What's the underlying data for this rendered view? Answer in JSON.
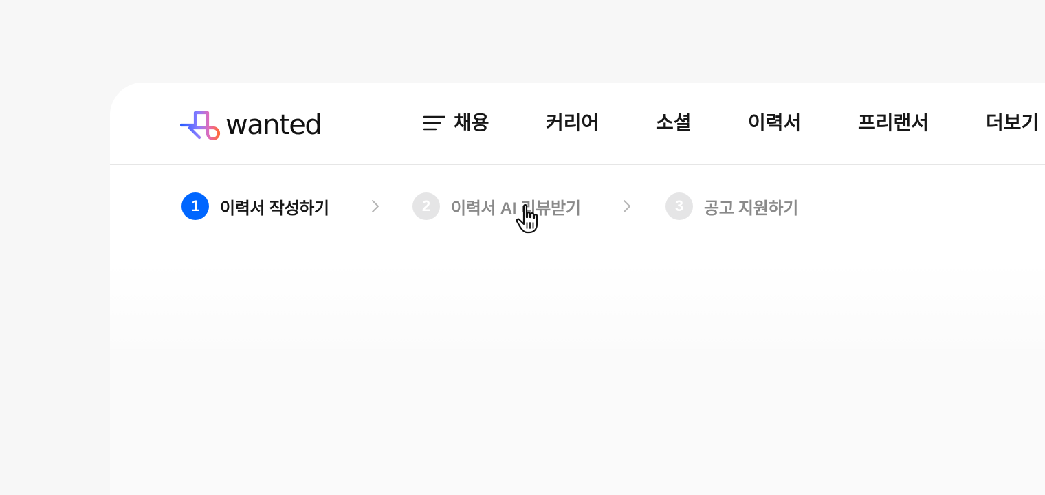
{
  "brand": {
    "name": "wanted",
    "colors": {
      "primary": "#0066ff",
      "text": "#171717",
      "muted": "#8a8a8a",
      "inactive_step": "#e5e5e6"
    },
    "logo_icon": "wanted-logo-mark"
  },
  "nav": {
    "menu_icon": "hamburger-menu-icon",
    "items": [
      {
        "label": "채용"
      },
      {
        "label": "커리어"
      },
      {
        "label": "소셜"
      },
      {
        "label": "이력서"
      },
      {
        "label": "프리랜서"
      },
      {
        "label": "더보기"
      }
    ]
  },
  "stepper": {
    "steps": [
      {
        "number": "1",
        "label": "이력서 작성하기",
        "state": "active"
      },
      {
        "number": "2",
        "label": "이력서 AI 리뷰받기",
        "state": "inactive"
      },
      {
        "number": "3",
        "label": "공고 지원하기",
        "state": "inactive"
      }
    ],
    "separator_icon": "chevron-right-icon"
  },
  "cursor": {
    "icon": "hand-pointer-cursor-icon"
  }
}
